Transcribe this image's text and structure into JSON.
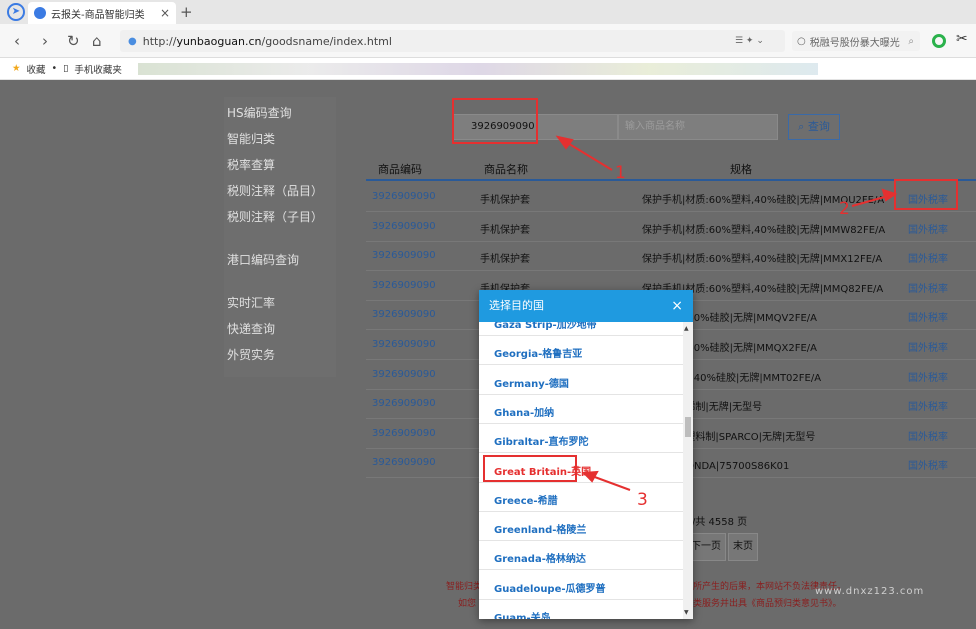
{
  "browser": {
    "tab_title": "云报关-商品智能归类",
    "url_prefix": "http://",
    "url_host": "yunbaoguan.cn",
    "url_path": "/goodsname/index.html",
    "search_placeholder": "税融号股份暴大曝光",
    "bookmarks": [
      "收藏",
      "手机收藏夹"
    ]
  },
  "sidebar": {
    "items": [
      "HS编码查询",
      "智能归类",
      "税率查算",
      "税则注释（品目）",
      "税则注释（子目）",
      "港口编码查询",
      "实时汇率",
      "快递查询",
      "外贸实务"
    ]
  },
  "search": {
    "code_value": "3926909090",
    "name_placeholder": "输入商品名称",
    "button_label": "查询"
  },
  "table": {
    "headers": [
      "商品编码",
      "商品名称",
      "规格"
    ],
    "rows": [
      {
        "code": "3926909090",
        "name": "手机保护套",
        "spec": "保护手机|材质:60%塑料,40%硅胶|无牌|MMQU2FE/A",
        "link": "国外税率"
      },
      {
        "code": "3926909090",
        "name": "手机保护套",
        "spec": "保护手机|材质:60%塑料,40%硅胶|无牌|MMW82FE/A",
        "link": "国外税率"
      },
      {
        "code": "3926909090",
        "name": "手机保护套",
        "spec": "保护手机|材质:60%塑料,40%硅胶|无牌|MMX12FE/A",
        "link": "国外税率"
      },
      {
        "code": "3926909090",
        "name": "手机保护套",
        "spec": "保护手机|材质:60%塑料,40%硅胶|无牌|MMQ82FE/A",
        "link": "国外税率"
      },
      {
        "code": "3926909090",
        "name": "",
        "spec": "60%塑料,40%硅胶|无牌|MMQV2FE/A",
        "link": "国外税率"
      },
      {
        "code": "3926909090",
        "name": "",
        "spec": "60%塑料,40%硅胶|无牌|MMQX2FE/A",
        "link": "国外税率"
      },
      {
        "code": "3926909090",
        "name": "",
        "spec": "E60%塑料,40%硅胶|无牌|MMT02FE/A",
        "link": "国外税率"
      },
      {
        "code": "3926909090",
        "name": "",
        "spec": "用|聚氯乙烯制|无牌|无型号",
        "link": "国外税率"
      },
      {
        "code": "3926909090",
        "name": "",
        "spec": "风防尘用|塑料制|SPARCO|无牌|无型号",
        "link": "国外税率"
      },
      {
        "code": "3926909090",
        "name": "",
        "spec": "|ABS料|HONDA|75700S86K01",
        "link": "国外税率"
      }
    ]
  },
  "pagination": {
    "total_text": "/共 4558 页",
    "next_label": "下一页",
    "last_label": "末页"
  },
  "footer": {
    "line1_left": "智能归类",
    "line1_right": "用所产生的后果，本网站不负法律责任。",
    "line2_left": "如您",
    "line2_right": "归类服务并出具《商品预归类意见书》。",
    "watermark": "www.dnxz123.com"
  },
  "modal": {
    "title": "选择目的国",
    "options": [
      "Gaza Strip-加沙地带",
      "Georgia-格鲁吉亚",
      "Germany-德国",
      "Ghana-加纳",
      "Gibraltar-直布罗陀",
      "Great Britain-英国",
      "Greece-希腊",
      "Greenland-格陵兰",
      "Grenada-格林纳达",
      "Guadeloupe-瓜德罗普",
      "Guam-关岛"
    ]
  },
  "annotations": [
    "1",
    "2",
    "3"
  ],
  "colors": {
    "accent": "#1f9ae0",
    "annotation": "#e53030",
    "link": "#2a5a98"
  }
}
